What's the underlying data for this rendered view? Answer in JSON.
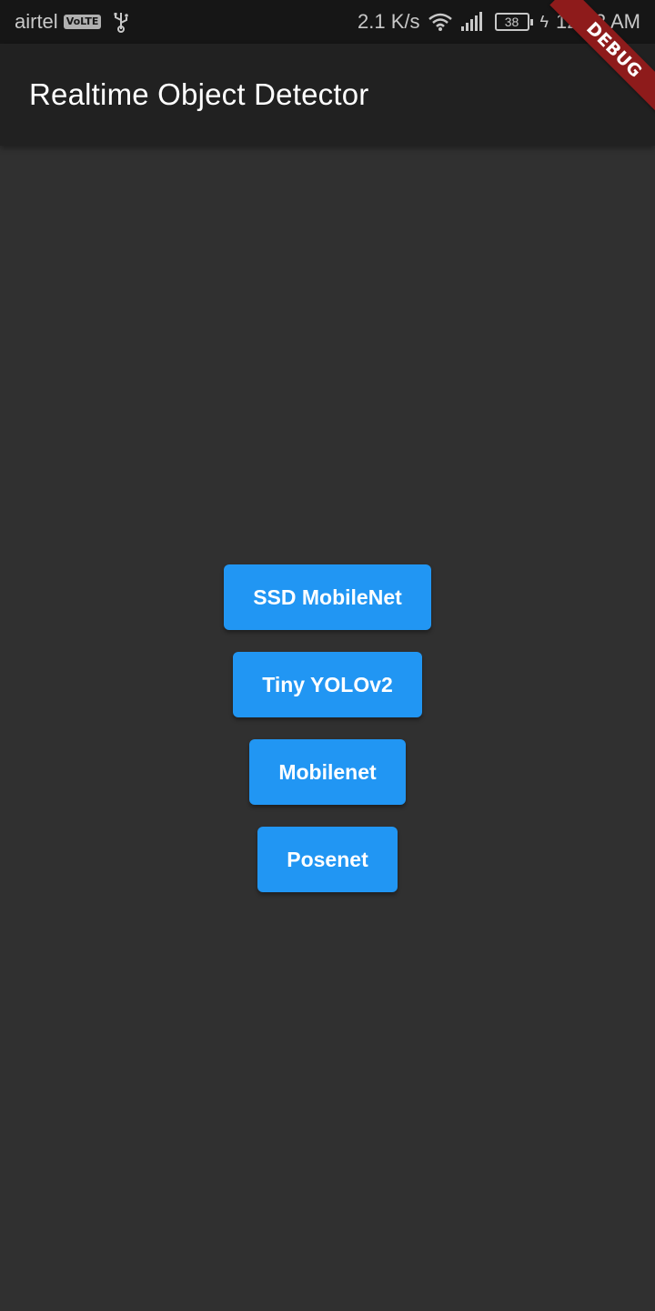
{
  "status_bar": {
    "carrier": "airtel",
    "volte": "VoLTE",
    "net_speed": "2.1 K/s",
    "battery": "38",
    "time": "12:42 AM",
    "icons": [
      "usb-icon",
      "wifi-icon",
      "signal-icon",
      "battery-icon",
      "charging-icon"
    ]
  },
  "app_bar": {
    "title": "Realtime Object Detector"
  },
  "debug_banner": "DEBUG",
  "buttons": [
    {
      "label": "SSD MobileNet"
    },
    {
      "label": "Tiny YOLOv2"
    },
    {
      "label": "Mobilenet"
    },
    {
      "label": "Posenet"
    }
  ],
  "colors": {
    "background": "#303030",
    "app_bar": "#212121",
    "status_bar": "#161616",
    "button": "#2196f3",
    "debug_banner": "#8e1b1b"
  }
}
